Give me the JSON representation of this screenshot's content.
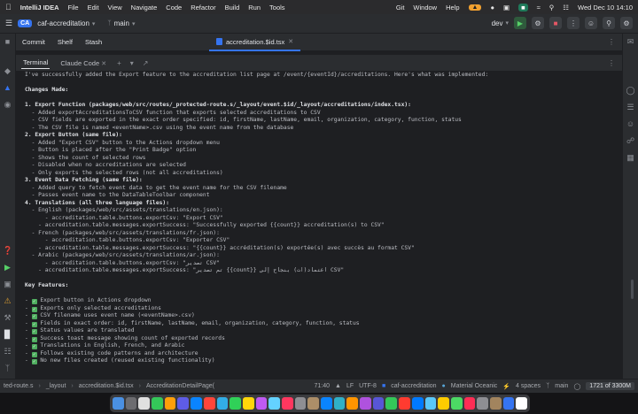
{
  "menubar": {
    "app_name": "IntelliJ IDEA",
    "menus": [
      "File",
      "Edit",
      "View",
      "Navigate",
      "Code",
      "Refactor",
      "Build",
      "Run",
      "Tools"
    ],
    "right_menus": [
      "Git",
      "Window",
      "Help"
    ],
    "clock": "Wed Dec 10  14:10"
  },
  "titlebar": {
    "project_badge": "CA",
    "project_name": "caf-accreditation",
    "branch": "main",
    "run_config": "dev"
  },
  "editor": {
    "vcs_tabs": [
      "Commit",
      "Shelf",
      "Stash"
    ],
    "file_tab": "accreditation.$id.tsx"
  },
  "terminal": {
    "tabs": [
      "Terminal",
      "Claude Code"
    ],
    "lines": [
      {
        "t": "I've successfully added the Export feature to the accreditation list page at /event/{eventId}/accreditations. Here's what was implemented:"
      },
      {
        "t": ""
      },
      {
        "t": "Changes Made:",
        "b": true
      },
      {
        "t": ""
      },
      {
        "t": "1. Export Function (packages/web/src/routes/_protected-route.s/_layout/event.$id/_layout/accreditations/index.tsx):",
        "b": true
      },
      {
        "t": "  - Added exportAccreditationsToCSV function that exports selected accreditations to CSV"
      },
      {
        "t": "  - CSV fields are exported in the exact order specified: id, firstName, lastName, email, organization, category, function, status"
      },
      {
        "t": "  - The CSV file is named <eventName>.csv using the event name from the database"
      },
      {
        "t": "2. Export Button (same file):",
        "b": true
      },
      {
        "t": "  - Added \"Export CSV\" button to the Actions dropdown menu"
      },
      {
        "t": "  - Button is placed after the \"Print Badge\" option"
      },
      {
        "t": "  - Shows the count of selected rows"
      },
      {
        "t": "  - Disabled when no accreditations are selected"
      },
      {
        "t": "  - Only exports the selected rows (not all accreditations)"
      },
      {
        "t": "3. Event Data Fetching (same file):",
        "b": true
      },
      {
        "t": "  - Added query to fetch event data to get the event name for the CSV filename"
      },
      {
        "t": "  - Passes event name to the DataTableToolbar component"
      },
      {
        "t": "4. Translations (all three language files):",
        "b": true
      },
      {
        "t": "  - English (packages/web/src/assets/translations/en.json):"
      },
      {
        "t": "      - accreditation.table.buttons.exportCsv: \"Export CSV\""
      },
      {
        "t": "    - accreditation.table.messages.exportSuccess: \"Successfully exported {{count}} accreditation(s) to CSV\""
      },
      {
        "t": "  - French (packages/web/src/assets/translations/fr.json):"
      },
      {
        "t": "      - accreditation.table.buttons.exportCsv: \"Exporter CSV\""
      },
      {
        "t": "    - accreditation.table.messages.exportSuccess: \"{{count}} accréditation(s) exportée(s) avec succès au format CSV\""
      },
      {
        "t": "  - Arabic (packages/web/src/assets/translations/ar.json):"
      },
      {
        "t": "      - accreditation.table.buttons.exportCsv: \"تصدير CSV\""
      },
      {
        "t": "    - accreditation.table.messages.exportSuccess: \"تم تصدير {{count}} اعتماد(ات) بنجاح إلى CSV\""
      },
      {
        "t": ""
      },
      {
        "t": "Key Features:",
        "b": true
      },
      {
        "t": ""
      },
      {
        "t": " Export button in Actions dropdown",
        "c": true
      },
      {
        "t": " Exports only selected accreditations",
        "c": true
      },
      {
        "t": " CSV filename uses event name (<eventName>.csv)",
        "c": true
      },
      {
        "t": " Fields in exact order: id, firstName, lastName, email, organization, category, function, status",
        "c": true
      },
      {
        "t": " Status values are translated",
        "c": true
      },
      {
        "t": " Success toast message showing count of exported records",
        "c": true
      },
      {
        "t": " Translations in English, French, and Arabic",
        "c": true
      },
      {
        "t": " Follows existing code patterns and architecture",
        "c": true
      },
      {
        "t": " No new files created (reused existing functionality)",
        "c": true
      }
    ]
  },
  "statusbar": {
    "breadcrumb": [
      "ted-route.s",
      "_layout",
      "accreditation.$id.tsx",
      "AccreditationDetailPage("
    ],
    "position": "71:40",
    "line_sep": "LF",
    "encoding": "UTF-8",
    "project": "caf-accreditation",
    "theme": "Material Oceanic",
    "indent": "4 spaces",
    "branch": "main",
    "memory": "1721 of 3300M"
  },
  "colors": {
    "accent": "#3574f0",
    "check": "#4fae5f",
    "background": "#1e1f22",
    "panel": "#2b2d30"
  }
}
